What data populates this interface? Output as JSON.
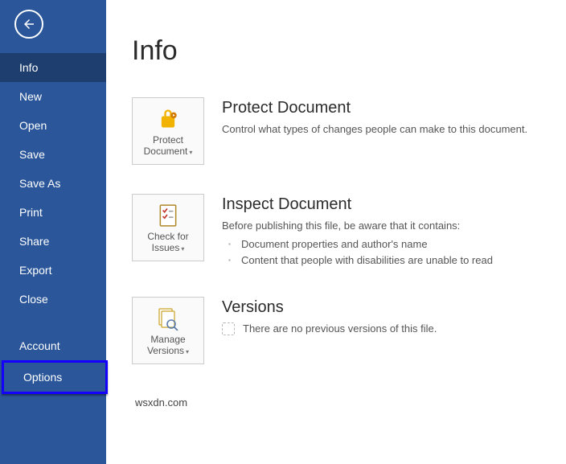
{
  "sidebar": {
    "items": [
      {
        "label": "Info",
        "selected": true
      },
      {
        "label": "New"
      },
      {
        "label": "Open"
      },
      {
        "label": "Save"
      },
      {
        "label": "Save As"
      },
      {
        "label": "Print"
      },
      {
        "label": "Share"
      },
      {
        "label": "Export"
      },
      {
        "label": "Close"
      }
    ],
    "lower_items": [
      {
        "label": "Account"
      },
      {
        "label": "Options",
        "highlighted": true
      }
    ]
  },
  "page": {
    "title": "Info"
  },
  "protect": {
    "button_label": "Protect Document",
    "title": "Protect Document",
    "description": "Control what types of changes people can make to this document."
  },
  "inspect": {
    "button_label": "Check for Issues",
    "title": "Inspect Document",
    "description": "Before publishing this file, be aware that it contains:",
    "bullets": [
      "Document properties and author's name",
      "Content that people with disabilities are unable to read"
    ]
  },
  "versions": {
    "button_label": "Manage Versions",
    "title": "Versions",
    "description": "There are no previous versions of this file."
  },
  "watermark": "wsxdn.com"
}
